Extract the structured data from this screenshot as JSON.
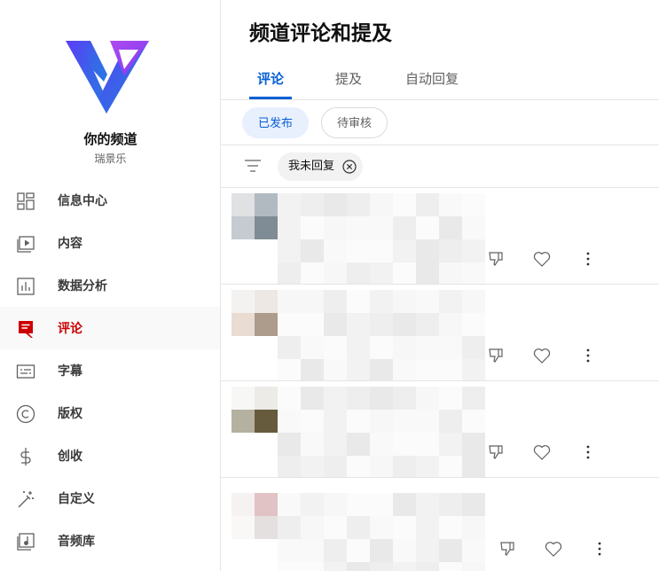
{
  "channel": {
    "name": "你的频道",
    "subtitle": "瑞景乐"
  },
  "sidebar": {
    "items": [
      {
        "label": "信息中心",
        "icon": "dashboard-icon",
        "active": false
      },
      {
        "label": "内容",
        "icon": "content-icon",
        "active": false
      },
      {
        "label": "数据分析",
        "icon": "analytics-icon",
        "active": false
      },
      {
        "label": "评论",
        "icon": "comments-icon",
        "active": true
      },
      {
        "label": "字幕",
        "icon": "subtitles-icon",
        "active": false
      },
      {
        "label": "版权",
        "icon": "copyright-icon",
        "active": false
      },
      {
        "label": "创收",
        "icon": "monetization-icon",
        "active": false
      },
      {
        "label": "自定义",
        "icon": "customization-icon",
        "active": false
      },
      {
        "label": "音频库",
        "icon": "audio-library-icon",
        "active": false
      }
    ]
  },
  "main": {
    "title": "频道评论和提及",
    "tabs": [
      {
        "label": "评论",
        "active": true
      },
      {
        "label": "提及",
        "active": false
      },
      {
        "label": "自动回复",
        "active": false
      }
    ],
    "status_chips": [
      {
        "label": "已发布",
        "selected": true
      },
      {
        "label": "待审核",
        "selected": false
      }
    ],
    "filter": {
      "chip_label": "我未回复"
    }
  },
  "colors": {
    "accent_blue": "#065fd4",
    "active_red": "#cc0000",
    "logo_purple": "#8a2be2",
    "logo_blue": "#3b5bdb"
  },
  "comments": [
    {
      "avatar": [
        "#dfe1e3",
        "#b1bac1",
        "#c5cbd1",
        "#7f8c95"
      ]
    },
    {
      "avatar": [
        "#f4f2f0",
        "#ede8e4",
        "#e8dcd3",
        "#ad9c8c"
      ]
    },
    {
      "avatar": [
        "#f7f7f6",
        "#ecebe8",
        "#b5b1a1",
        "#675b3e"
      ]
    },
    {
      "avatar": [
        "#f7f2f2",
        "#e1c3c6",
        "#faf8f6",
        "#e3e0df"
      ]
    }
  ]
}
